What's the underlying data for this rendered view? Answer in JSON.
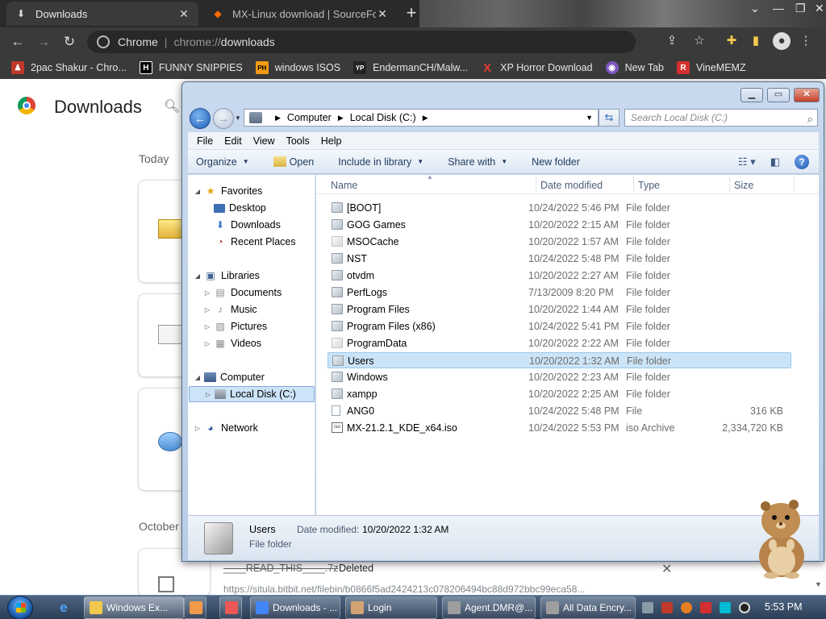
{
  "chrome": {
    "tabs": [
      {
        "title": "Downloads",
        "active": true
      },
      {
        "title": "MX-Linux download | SourceFor",
        "active": false
      }
    ],
    "omnibox": {
      "site_label": "Chrome",
      "url_prefix": "chrome://",
      "url_path": "downloads"
    },
    "bookmarks": [
      {
        "label": "2pac Shakur - Chro...",
        "icon": "flame-icon",
        "color": "#c0392b",
        "glyph": "♟"
      },
      {
        "label": "FUNNY SNIPPIES",
        "icon": "h-icon",
        "color": "#000000",
        "glyph": "H"
      },
      {
        "label": "windows ISOS",
        "icon": "ph-icon",
        "color": "#f39c12",
        "glyph": "PH"
      },
      {
        "label": "EndermanCH/Malw...",
        "icon": "yp-icon",
        "color": "#222222",
        "glyph": "YP"
      },
      {
        "label": "XP Horror Download",
        "icon": "x-icon",
        "color": "#e53935",
        "glyph": "X"
      },
      {
        "label": "New Tab",
        "icon": "globe-icon",
        "color": "#7e57c2",
        "glyph": "◉"
      },
      {
        "label": "VineMEMZ",
        "icon": "r-icon",
        "color": "#d32f2f",
        "glyph": "R"
      }
    ]
  },
  "downloads_page": {
    "title": "Downloads",
    "section_today": "Today",
    "section_october": "October",
    "deleted_item": {
      "name": "____READ_THIS____.7z",
      "status": "Deleted",
      "url": "https://situla.bitbit.net/filebin/b0866f5ad2424213c078206494bc88d972bbc99eca58..."
    }
  },
  "explorer": {
    "breadcrumb": [
      "Computer",
      "Local Disk (C:)"
    ],
    "search_placeholder": "Search Local Disk (C:)",
    "menu": [
      "File",
      "Edit",
      "View",
      "Tools",
      "Help"
    ],
    "commands": {
      "organize": "Organize",
      "open": "Open",
      "include_in_library": "Include in library",
      "share_with": "Share with",
      "new_folder": "New folder"
    },
    "columns": {
      "name": "Name",
      "date": "Date modified",
      "type": "Type",
      "size": "Size"
    },
    "nav": {
      "favorites": "Favorites",
      "desktop": "Desktop",
      "downloads": "Downloads",
      "recent_places": "Recent Places",
      "libraries": "Libraries",
      "documents": "Documents",
      "music": "Music",
      "pictures": "Pictures",
      "videos": "Videos",
      "computer": "Computer",
      "local_disk": "Local Disk (C:)",
      "network": "Network"
    },
    "files": [
      {
        "name": "[BOOT]",
        "date": "10/24/2022 5:46 PM",
        "type": "File folder",
        "size": "",
        "icon": "folder"
      },
      {
        "name": "GOG Games",
        "date": "10/20/2022 2:15 AM",
        "type": "File folder",
        "size": "",
        "icon": "folder"
      },
      {
        "name": "MSOCache",
        "date": "10/20/2022 1:57 AM",
        "type": "File folder",
        "size": "",
        "icon": "folder-light"
      },
      {
        "name": "NST",
        "date": "10/24/2022 5:48 PM",
        "type": "File folder",
        "size": "",
        "icon": "folder"
      },
      {
        "name": "otvdm",
        "date": "10/20/2022 2:27 AM",
        "type": "File folder",
        "size": "",
        "icon": "folder"
      },
      {
        "name": "PerfLogs",
        "date": "7/13/2009 8:20 PM",
        "type": "File folder",
        "size": "",
        "icon": "folder"
      },
      {
        "name": "Program Files",
        "date": "10/20/2022 1:44 AM",
        "type": "File folder",
        "size": "",
        "icon": "folder"
      },
      {
        "name": "Program Files (x86)",
        "date": "10/24/2022 5:41 PM",
        "type": "File folder",
        "size": "",
        "icon": "folder"
      },
      {
        "name": "ProgramData",
        "date": "10/20/2022 2:22 AM",
        "type": "File folder",
        "size": "",
        "icon": "folder-light"
      },
      {
        "name": "Users",
        "date": "10/20/2022 1:32 AM",
        "type": "File folder",
        "size": "",
        "icon": "folder",
        "selected": true
      },
      {
        "name": "Windows",
        "date": "10/20/2022 2:23 AM",
        "type": "File folder",
        "size": "",
        "icon": "folder"
      },
      {
        "name": "xampp",
        "date": "10/20/2022 2:25 AM",
        "type": "File folder",
        "size": "",
        "icon": "folder"
      },
      {
        "name": "ANG0",
        "date": "10/24/2022 5:48 PM",
        "type": "File",
        "size": "316 KB",
        "icon": "file"
      },
      {
        "name": "MX-21.2.1_KDE_x64.iso",
        "date": "10/24/2022 5:53 PM",
        "type": "iso Archive",
        "size": "2,334,720 KB",
        "icon": "iso"
      }
    ],
    "details": {
      "name": "Users",
      "type": "File folder",
      "modified_label": "Date modified:",
      "modified_value": "10/20/2022 1:32 AM"
    }
  },
  "taskbar": {
    "tasks": [
      {
        "label": "Windows Ex...",
        "icon_color": "#f2c94c",
        "active": true
      },
      {
        "label": "",
        "icon_color": "#f2994a",
        "active": false
      },
      {
        "label": "",
        "icon_color": "#eb5757",
        "active": false
      },
      {
        "label": "Downloads - ...",
        "icon_color": "#4285f4",
        "active": false
      },
      {
        "label": "Login",
        "icon_color": "#d4a373",
        "active": false
      },
      {
        "label": "Agent.DMR@...",
        "icon_color": "#9e9e9e",
        "active": false
      },
      {
        "label": "All Data Encry...",
        "icon_color": "#9e9e9e",
        "active": false
      }
    ],
    "clock": "5:53 PM"
  }
}
